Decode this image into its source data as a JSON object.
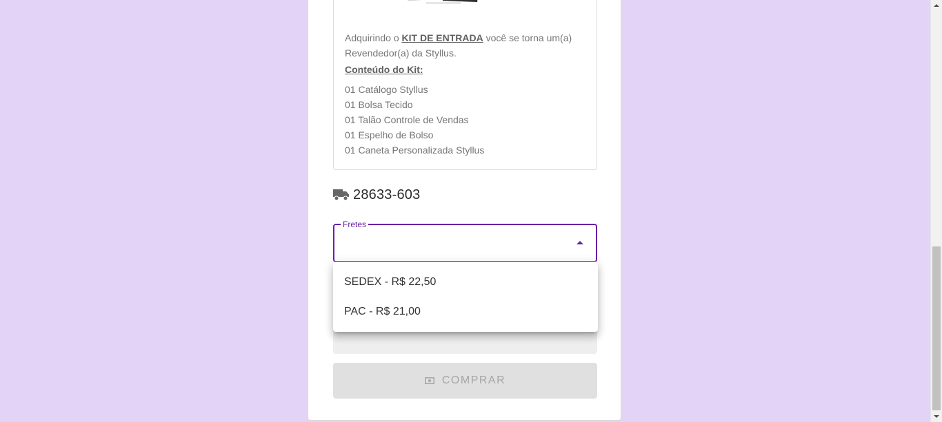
{
  "kit": {
    "intro_before": "Adquirindo o ",
    "intro_bold": "KIT DE ENTRADA",
    "intro_after": " você se torna um(a) Revendedor(a) da Styllus.",
    "contents_heading": "Conteúdo do Kit:",
    "items": [
      "01 Catálogo Styllus",
      "01 Bolsa Tecido",
      "01 Talão Controle de Vendas",
      "01 Espelho de Bolso",
      "01 Caneta Personalizada Styllus"
    ]
  },
  "shipping": {
    "icon": "truck-icon",
    "cep": "28633-603"
  },
  "freight_select": {
    "label": "Fretes",
    "value": "",
    "expanded": true
  },
  "freight_options": [
    "SEDEX - R$ 22,50",
    "PAC - R$ 21,00"
  ],
  "buy_button": {
    "icon": "money-icon",
    "label": "COMPRAR",
    "disabled": true
  },
  "colors": {
    "background": "#e3d4f7",
    "accent": "#6a1fa6",
    "button_disabled": "#e0e0e0"
  }
}
